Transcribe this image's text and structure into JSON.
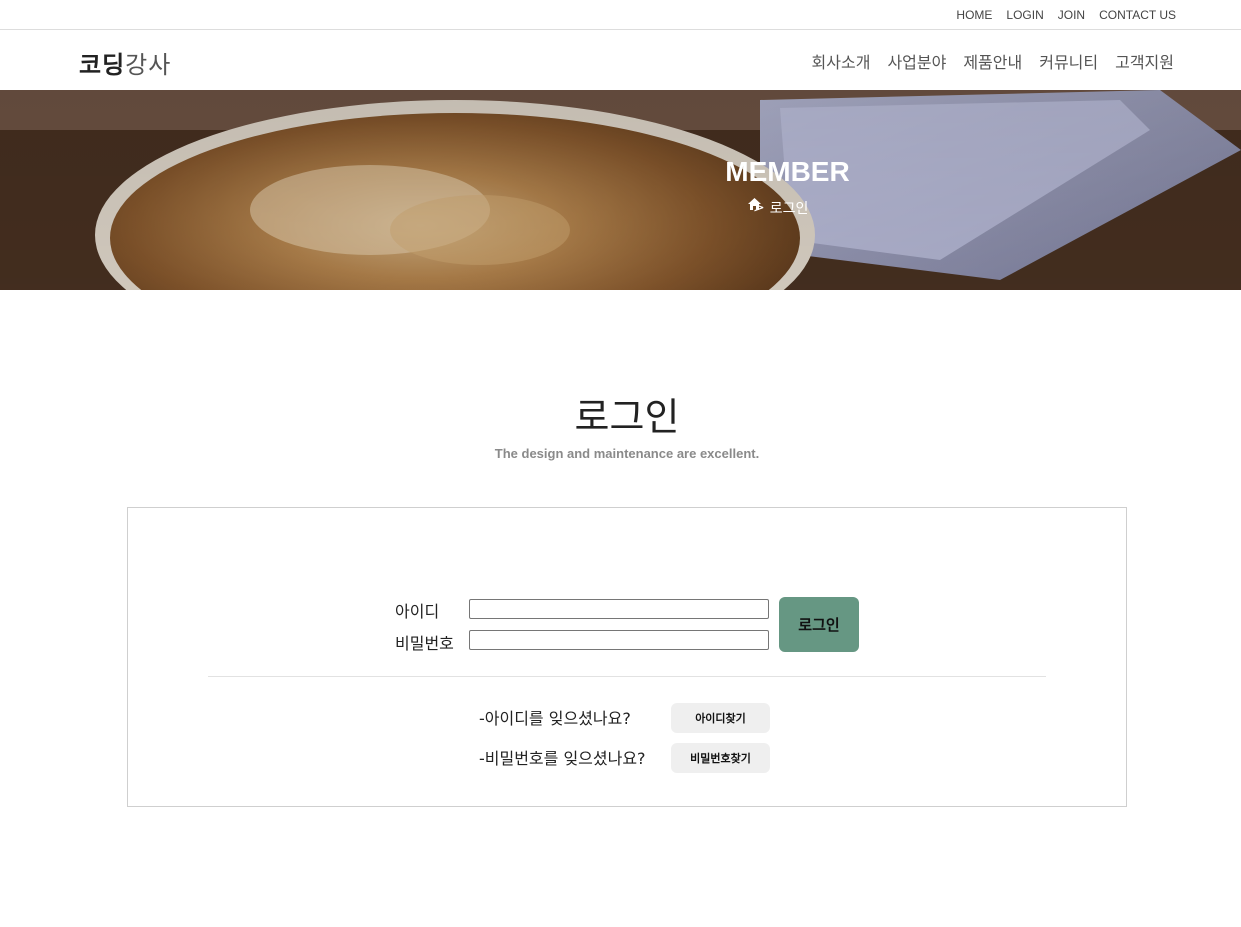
{
  "topbar": {
    "links": [
      "HOME",
      "LOGIN",
      "JOIN",
      "CONTACT US"
    ]
  },
  "header": {
    "logo_part1": "코딩",
    "logo_part2": "강사",
    "nav": [
      "회사소개",
      "사업분야",
      "제품안내",
      "커뮤니티",
      "고객지원"
    ]
  },
  "hero": {
    "title": "MEMBER",
    "breadcrumb_icon": "home-icon",
    "breadcrumb_sep": ">",
    "breadcrumb_current": "로그인"
  },
  "page": {
    "title": "로그인",
    "subtitle": "The design and maintenance are excellent."
  },
  "login": {
    "id_label": "아이디",
    "id_value": "",
    "pw_label": "비밀번호",
    "pw_value": "",
    "button": "로그인",
    "find_id_text": "-아이디를 잊으셨나요?",
    "find_id_button": "아이디찾기",
    "find_pw_text": "-비밀번호를 잊으셨나요?",
    "find_pw_button": "비밀번호찾기"
  },
  "colors": {
    "accent": "#669783",
    "border": "#cfcfcf",
    "subtext": "#8a8a8a"
  }
}
